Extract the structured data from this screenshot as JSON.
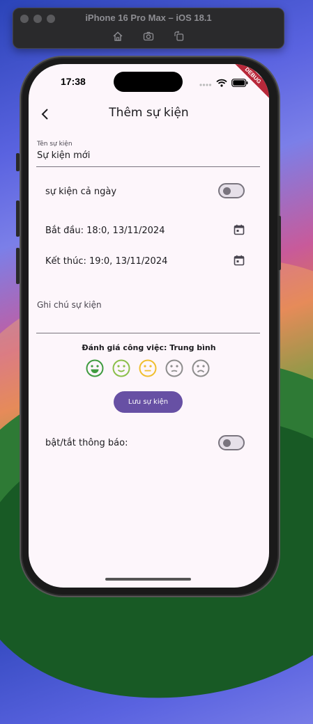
{
  "simulator": {
    "title": "iPhone 16 Pro Max – iOS 18.1",
    "tools": [
      "home-icon",
      "screenshot-icon",
      "rotate-icon"
    ]
  },
  "status_bar": {
    "time": "17:38",
    "debug_label": "DEBUG"
  },
  "appbar": {
    "title": "Thêm sự kiện"
  },
  "form": {
    "name_label": "Tên sự kiện",
    "name_value": "Sự kiện mới",
    "all_day_label": "sự kiện cả ngày",
    "all_day_on": false,
    "start_label": "Bắt đầu: 18:0, 13/11/2024",
    "end_label": "Kết thúc: 19:0, 13/11/2024",
    "note_placeholder": "Ghi chú sự kiện",
    "rating_title": "Đánh giá công việc: Trung bình",
    "ratings": [
      {
        "icon": "very-happy-face-icon",
        "color": "#3f9b3f"
      },
      {
        "icon": "happy-face-icon",
        "color": "#8bbf4a"
      },
      {
        "icon": "neutral-face-icon",
        "color": "#f0bf2f"
      },
      {
        "icon": "sad-face-icon",
        "color": "#8d8d8d"
      },
      {
        "icon": "very-sad-face-icon",
        "color": "#8d8d8d"
      }
    ],
    "save_button": "Lưu sự kiện",
    "notify_label": "bật/tắt thông báo:",
    "notify_on": false
  },
  "colors": {
    "primary": "#6750a4",
    "screen_bg": "#fdf6fb"
  }
}
